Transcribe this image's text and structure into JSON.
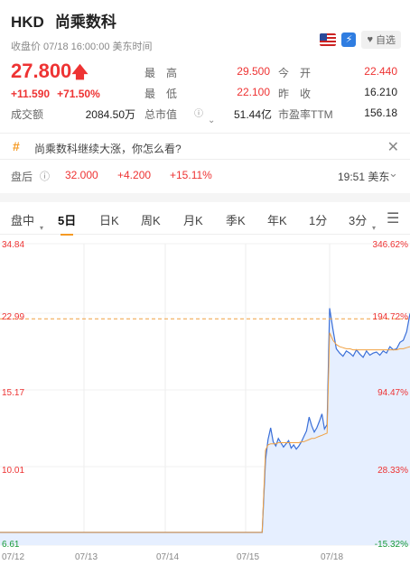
{
  "header": {
    "currency": "HKD",
    "name": "尚乘数科",
    "close_info": "收盘价 07/18 16:00:00 美东时间",
    "watch_label": "自选"
  },
  "quote": {
    "price": "27.800",
    "change": "+11.590",
    "change_pct": "+71.50%",
    "stats": [
      {
        "label": "最　高",
        "value": "29.500",
        "color": "red"
      },
      {
        "label": "今　开",
        "value": "22.440",
        "color": "red"
      },
      {
        "label": "最　低",
        "value": "22.100",
        "color": "red"
      },
      {
        "label": "昨　收",
        "value": "16.210",
        "color": "plain"
      },
      {
        "label": "成交额",
        "value": "2084.50万",
        "color": "plain"
      },
      {
        "label": "总市值",
        "value": "51.44亿",
        "color": "plain"
      },
      {
        "label": "市盈率TTM",
        "value": "156.18",
        "color": "plain"
      }
    ]
  },
  "news": {
    "text": "尚乘数科继续大涨，你怎么看?"
  },
  "after_hours": {
    "label": "盘后",
    "price": "32.000",
    "change": "+4.200",
    "change_pct": "+15.11%",
    "time": "19:51 美东"
  },
  "tabs": [
    "盘中",
    "5日",
    "日K",
    "周K",
    "月K",
    "季K",
    "年K",
    "1分",
    "3分"
  ],
  "colors": {
    "up": "#e33333",
    "down": "#1a9b3a",
    "accent": "#f59a23",
    "line": "#3a6fd8",
    "avg": "#f0a040"
  },
  "chart_data": {
    "type": "line",
    "y_labels_left": [
      "34.84",
      "22.99",
      "15.17",
      "10.01",
      "6.61"
    ],
    "y_labels_right": [
      "346.62%",
      "194.72%",
      "94.47%",
      "28.33%",
      "-15.32%"
    ],
    "x_labels": [
      "07/12",
      "07/13",
      "07/14",
      "07/15",
      "07/18"
    ],
    "ylim": [
      6.61,
      34.84
    ],
    "reference_price": 27.8,
    "series": [
      {
        "values": [
          7.8,
          7.8,
          7.8,
          7.8,
          7.8,
          7.8,
          7.8,
          7.8,
          7.8,
          7.8,
          7.8,
          7.8,
          7.8,
          7.8,
          7.8,
          7.8,
          7.8,
          7.8,
          7.8,
          7.8,
          7.8,
          7.8,
          7.8,
          7.8,
          7.8,
          7.8,
          7.8,
          7.8,
          7.8,
          7.8,
          7.8,
          7.8,
          7.8,
          7.8,
          7.8,
          7.8,
          7.8,
          7.8,
          7.8,
          7.8,
          7.8,
          7.8,
          7.8,
          7.8,
          7.8,
          7.8,
          7.8,
          7.8,
          7.8,
          7.8,
          7.8,
          7.8,
          7.8,
          7.8,
          7.8,
          7.8,
          7.8,
          7.8,
          7.8,
          7.8,
          7.8,
          7.8,
          7.8,
          7.8,
          7.8,
          7.8,
          7.8,
          7.8,
          7.8,
          7.8,
          7.8,
          7.8,
          7.8,
          7.8,
          7.8,
          7.8,
          7.8,
          7.8,
          7.8,
          7.8,
          14.6,
          16.5,
          17.6,
          16.3,
          15.9,
          16.6,
          16.2,
          15.8,
          16.1,
          16.4,
          15.7,
          16.0,
          15.6,
          15.9,
          16.3,
          16.8,
          17.3,
          18.6,
          17.8,
          17.2,
          17.6,
          18.2,
          18.9,
          17.5,
          17.9,
          28.8,
          26.8,
          25.0,
          24.6,
          24.3,
          24.8,
          24.6,
          24.3,
          24.9,
          24.5,
          24.2,
          24.8,
          24.4,
          24.6,
          24.7,
          24.4,
          24.8,
          24.6,
          25.2,
          24.9,
          25.0,
          25.6,
          25.8,
          26.6,
          28.3
        ]
      },
      {
        "values": [
          7.8,
          7.8,
          7.8,
          7.8,
          7.8,
          7.8,
          7.8,
          7.8,
          7.8,
          7.8,
          7.8,
          7.8,
          7.8,
          7.8,
          7.8,
          7.8,
          7.8,
          7.8,
          7.8,
          7.8,
          7.8,
          7.8,
          7.8,
          7.8,
          7.8,
          7.8,
          7.8,
          7.8,
          7.8,
          7.8,
          7.8,
          7.8,
          7.8,
          7.8,
          7.8,
          7.8,
          7.8,
          7.8,
          7.8,
          7.8,
          7.8,
          7.8,
          7.8,
          7.8,
          7.8,
          7.8,
          7.8,
          7.8,
          7.8,
          7.8,
          7.8,
          7.8,
          7.8,
          7.8,
          7.8,
          7.8,
          7.8,
          7.8,
          7.8,
          7.8,
          7.8,
          7.8,
          7.8,
          7.8,
          7.8,
          7.8,
          7.8,
          7.8,
          7.8,
          7.8,
          7.8,
          7.8,
          7.8,
          7.8,
          7.8,
          7.8,
          7.8,
          7.8,
          7.8,
          7.8,
          15.5,
          16.0,
          16.1,
          16.1,
          16.1,
          16.2,
          16.2,
          16.2,
          16.2,
          16.2,
          16.2,
          16.2,
          16.2,
          16.2,
          16.3,
          16.3,
          16.4,
          16.5,
          16.6,
          16.6,
          16.7,
          16.8,
          16.9,
          17.0,
          17.1,
          26.5,
          25.8,
          25.4,
          25.2,
          25.1,
          25.0,
          25.0,
          24.9,
          24.9,
          24.9,
          24.9,
          24.9,
          24.9,
          24.9,
          24.9,
          24.9,
          24.9,
          24.9,
          24.9,
          24.9,
          24.9,
          25.0,
          25.0,
          25.1,
          25.2
        ]
      }
    ]
  }
}
